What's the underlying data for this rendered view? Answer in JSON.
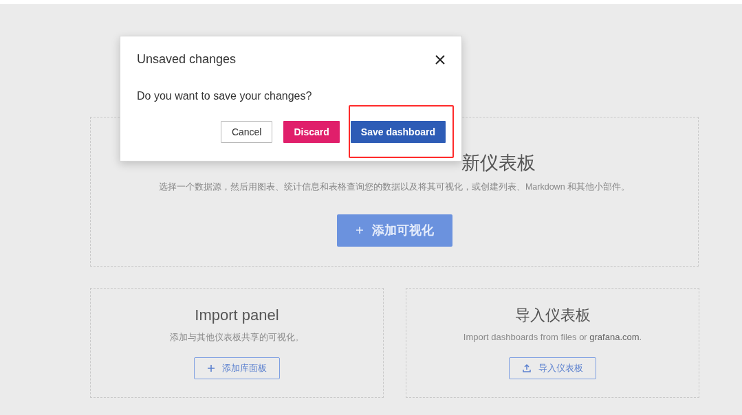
{
  "new_dashboard": {
    "title_visible": "新仪表板",
    "description": "选择一个数据源，然后用图表、统计信息和表格查询您的数据以及将其可视化，或创建列表、Markdown 和其他小部件。",
    "button": {
      "kind": "add",
      "label": "添加可视化"
    }
  },
  "cards": [
    {
      "title": "Import panel",
      "description": "添加与其他仪表板共享的可视化。",
      "button": {
        "kind": "add",
        "label": "添加库面板"
      }
    },
    {
      "title": "导入仪表板",
      "description": "Import dashboards from files or **grafana.com**.",
      "button": {
        "kind": "import",
        "label": "导入仪表板"
      }
    }
  ],
  "dialog": {
    "title": "Unsaved changes",
    "message": "Do you want to save your changes?",
    "buttons": [
      {
        "label": "Cancel",
        "kind": "secondary",
        "highlighted": false
      },
      {
        "label": "Discard",
        "kind": "destructive",
        "highlighted": false
      },
      {
        "label": "Save dashboard",
        "kind": "primary",
        "highlighted": true
      }
    ]
  }
}
